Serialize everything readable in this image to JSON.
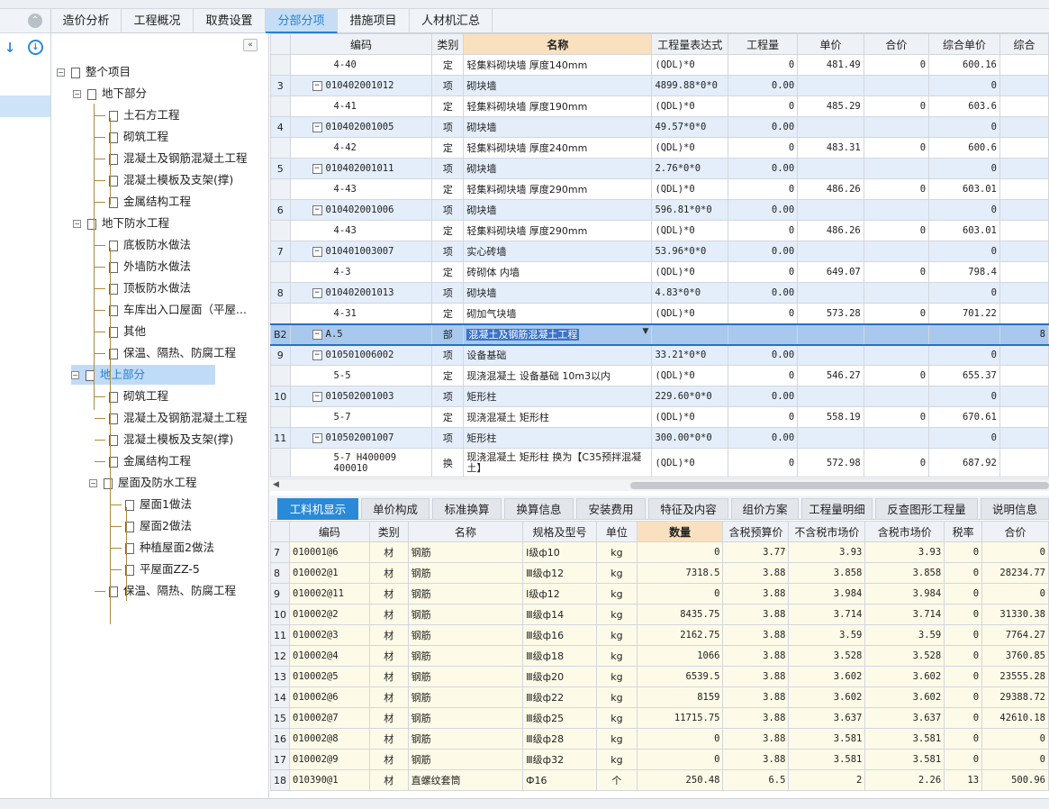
{
  "tabs": [
    "造价分析",
    "工程概况",
    "取费设置",
    "分部分项",
    "措施项目",
    "人材机汇总"
  ],
  "tree": {
    "root": "整个项目",
    "nodes": [
      {
        "label": "地下部分",
        "level": 1,
        "toggle": "−"
      },
      {
        "label": "土石方工程",
        "level": 2
      },
      {
        "label": "砌筑工程",
        "level": 2
      },
      {
        "label": "混凝土及钢筋混凝土工程",
        "level": 2
      },
      {
        "label": "混凝土模板及支架(撑)",
        "level": 2
      },
      {
        "label": "金属结构工程",
        "level": 2
      },
      {
        "label": "地下防水工程",
        "level": 1,
        "toggle": "−"
      },
      {
        "label": "底板防水做法",
        "level": 2
      },
      {
        "label": "外墙防水做法",
        "level": 2
      },
      {
        "label": "顶板防水做法",
        "level": 2
      },
      {
        "label": "车库出入口屋面（平屋...",
        "level": 2
      },
      {
        "label": "其他",
        "level": 2
      },
      {
        "label": "保温、隔热、防腐工程",
        "level": 2
      },
      {
        "label": "地上部分",
        "level": 1,
        "toggle": "−",
        "selected": true
      },
      {
        "label": "砌筑工程",
        "level": 2
      },
      {
        "label": "混凝土及钢筋混凝土工程",
        "level": 2
      },
      {
        "label": "混凝土模板及支架(撑)",
        "level": 2
      },
      {
        "label": "金属结构工程",
        "level": 2
      },
      {
        "label": "屋面及防水工程",
        "level": 2,
        "toggle": "−"
      },
      {
        "label": "屋面1做法",
        "level": 3
      },
      {
        "label": "屋面2做法",
        "level": 3
      },
      {
        "label": "种植屋面2做法",
        "level": 3
      },
      {
        "label": "平屋面ZZ-5",
        "level": 3
      },
      {
        "label": "保温、隔热、防腐工程",
        "level": 2
      }
    ]
  },
  "upper": {
    "headers": [
      "编码",
      "类别",
      "名称",
      "工程量表达式",
      "工程量",
      "单价",
      "合价",
      "综合单价",
      "综合"
    ],
    "rows": [
      {
        "rn": "",
        "code": "4-40",
        "type": "定",
        "name": "轻集料砌块墙 厚度140mm",
        "expr": "(QDL)*0",
        "qty": "0",
        "price": "481.49",
        "total": "0",
        "comp": "600.16",
        "kind": "ding"
      },
      {
        "rn": "3",
        "code": "010402001012",
        "type": "项",
        "name": "砌块墙",
        "expr": "4899.88*0*0",
        "qty": "0.00",
        "price": "",
        "total": "",
        "comp": "0",
        "kind": "xiang"
      },
      {
        "rn": "",
        "code": "4-41",
        "type": "定",
        "name": "轻集料砌块墙 厚度190mm",
        "expr": "(QDL)*0",
        "qty": "0",
        "price": "485.29",
        "total": "0",
        "comp": "603.6",
        "kind": "ding"
      },
      {
        "rn": "4",
        "code": "010402001005",
        "type": "项",
        "name": "砌块墙",
        "expr": "49.57*0*0",
        "qty": "0.00",
        "price": "",
        "total": "",
        "comp": "0",
        "kind": "xiang"
      },
      {
        "rn": "",
        "code": "4-42",
        "type": "定",
        "name": "轻集料砌块墙 厚度240mm",
        "expr": "(QDL)*0",
        "qty": "0",
        "price": "483.31",
        "total": "0",
        "comp": "600.6",
        "kind": "ding"
      },
      {
        "rn": "5",
        "code": "010402001011",
        "type": "项",
        "name": "砌块墙",
        "expr": "2.76*0*0",
        "qty": "0.00",
        "price": "",
        "total": "",
        "comp": "0",
        "kind": "xiang"
      },
      {
        "rn": "",
        "code": "4-43",
        "type": "定",
        "name": "轻集料砌块墙 厚度290mm",
        "expr": "(QDL)*0",
        "qty": "0",
        "price": "486.26",
        "total": "0",
        "comp": "603.01",
        "kind": "ding"
      },
      {
        "rn": "6",
        "code": "010402001006",
        "type": "项",
        "name": "砌块墙",
        "expr": "596.81*0*0",
        "qty": "0.00",
        "price": "",
        "total": "",
        "comp": "0",
        "kind": "xiang"
      },
      {
        "rn": "",
        "code": "4-43",
        "type": "定",
        "name": "轻集料砌块墙 厚度290mm",
        "expr": "(QDL)*0",
        "qty": "0",
        "price": "486.26",
        "total": "0",
        "comp": "603.01",
        "kind": "ding"
      },
      {
        "rn": "7",
        "code": "010401003007",
        "type": "项",
        "name": "实心砖墙",
        "expr": "53.96*0*0",
        "qty": "0.00",
        "price": "",
        "total": "",
        "comp": "0",
        "kind": "xiang"
      },
      {
        "rn": "",
        "code": "4-3",
        "type": "定",
        "name": "砖砌体 内墙",
        "expr": "(QDL)*0",
        "qty": "0",
        "price": "649.07",
        "total": "0",
        "comp": "798.4",
        "kind": "ding"
      },
      {
        "rn": "8",
        "code": "010402001013",
        "type": "项",
        "name": "砌块墙",
        "expr": "4.83*0*0",
        "qty": "0.00",
        "price": "",
        "total": "",
        "comp": "0",
        "kind": "xiang"
      },
      {
        "rn": "",
        "code": "4-31",
        "type": "定",
        "name": "砌加气块墙",
        "expr": "(QDL)*0",
        "qty": "0",
        "price": "573.28",
        "total": "0",
        "comp": "701.22",
        "kind": "ding"
      },
      {
        "rn": "B2",
        "code": "A.5",
        "type": "部",
        "name": "混凝土及钢筋混凝土工程",
        "expr": "",
        "qty": "",
        "price": "",
        "total": "",
        "comp": "",
        "extra": "8",
        "kind": "bu"
      },
      {
        "rn": "9",
        "code": "010501006002",
        "type": "项",
        "name": "设备基础",
        "expr": "33.21*0*0",
        "qty": "0.00",
        "price": "",
        "total": "",
        "comp": "0",
        "kind": "xiang"
      },
      {
        "rn": "",
        "code": "5-5",
        "type": "定",
        "name": "现浇混凝土 设备基础 10m3以内",
        "expr": "(QDL)*0",
        "qty": "0",
        "price": "546.27",
        "total": "0",
        "comp": "655.37",
        "kind": "ding"
      },
      {
        "rn": "10",
        "code": "010502001003",
        "type": "项",
        "name": "矩形柱",
        "expr": "229.60*0*0",
        "qty": "0.00",
        "price": "",
        "total": "",
        "comp": "0",
        "kind": "xiang"
      },
      {
        "rn": "",
        "code": "5-7",
        "type": "定",
        "name": "现浇混凝土 矩形柱",
        "expr": "(QDL)*0",
        "qty": "0",
        "price": "558.19",
        "total": "0",
        "comp": "670.61",
        "kind": "ding"
      },
      {
        "rn": "11",
        "code": "010502001007",
        "type": "项",
        "name": "矩形柱",
        "expr": "300.00*0*0",
        "qty": "0.00",
        "price": "",
        "total": "",
        "comp": "0",
        "kind": "xiang"
      },
      {
        "rn": "",
        "code": "5-7 H400009 400010",
        "type": "换",
        "name": "现浇混凝土 矩形柱  换为【C35预拌混凝土】",
        "expr": "(QDL)*0",
        "qty": "0",
        "price": "572.98",
        "total": "0",
        "comp": "687.92",
        "kind": "huan"
      }
    ]
  },
  "bottom_tabs": [
    "工料机显示",
    "单价构成",
    "标准换算",
    "换算信息",
    "安装费用",
    "特征及内容",
    "组价方案",
    "工程量明细",
    "反查图形工程量",
    "说明信息"
  ],
  "lower": {
    "headers": [
      "编码",
      "类别",
      "名称",
      "规格及型号",
      "单位",
      "数量",
      "含税预算价",
      "不含税市场价",
      "含税市场价",
      "税率",
      "合价"
    ],
    "rows": [
      {
        "rn": "7",
        "code": "010001@6",
        "type": "材",
        "name": "钢筋",
        "spec": "Ⅰ级ф10",
        "unit": "kg",
        "qty": "0",
        "p1": "3.77",
        "p2": "3.93",
        "p3": "3.93",
        "rate": "0",
        "total": "0"
      },
      {
        "rn": "8",
        "code": "010002@1",
        "type": "材",
        "name": "钢筋",
        "spec": "Ⅲ级ф12",
        "unit": "kg",
        "qty": "7318.5",
        "p1": "3.88",
        "p2": "3.858",
        "p3": "3.858",
        "rate": "0",
        "total": "28234.77"
      },
      {
        "rn": "9",
        "code": "010002@11",
        "type": "材",
        "name": "钢筋",
        "spec": "Ⅰ级ф12",
        "unit": "kg",
        "qty": "0",
        "p1": "3.88",
        "p2": "3.984",
        "p3": "3.984",
        "rate": "0",
        "total": "0"
      },
      {
        "rn": "10",
        "code": "010002@2",
        "type": "材",
        "name": "钢筋",
        "spec": "Ⅲ级ф14",
        "unit": "kg",
        "qty": "8435.75",
        "p1": "3.88",
        "p2": "3.714",
        "p3": "3.714",
        "rate": "0",
        "total": "31330.38"
      },
      {
        "rn": "11",
        "code": "010002@3",
        "type": "材",
        "name": "钢筋",
        "spec": "Ⅲ级ф16",
        "unit": "kg",
        "qty": "2162.75",
        "p1": "3.88",
        "p2": "3.59",
        "p3": "3.59",
        "rate": "0",
        "total": "7764.27"
      },
      {
        "rn": "12",
        "code": "010002@4",
        "type": "材",
        "name": "钢筋",
        "spec": "Ⅲ级ф18",
        "unit": "kg",
        "qty": "1066",
        "p1": "3.88",
        "p2": "3.528",
        "p3": "3.528",
        "rate": "0",
        "total": "3760.85"
      },
      {
        "rn": "13",
        "code": "010002@5",
        "type": "材",
        "name": "钢筋",
        "spec": "Ⅲ级ф20",
        "unit": "kg",
        "qty": "6539.5",
        "p1": "3.88",
        "p2": "3.602",
        "p3": "3.602",
        "rate": "0",
        "total": "23555.28"
      },
      {
        "rn": "14",
        "code": "010002@6",
        "type": "材",
        "name": "钢筋",
        "spec": "Ⅲ级ф22",
        "unit": "kg",
        "qty": "8159",
        "p1": "3.88",
        "p2": "3.602",
        "p3": "3.602",
        "rate": "0",
        "total": "29388.72"
      },
      {
        "rn": "15",
        "code": "010002@7",
        "type": "材",
        "name": "钢筋",
        "spec": "Ⅲ级ф25",
        "unit": "kg",
        "qty": "11715.75",
        "p1": "3.88",
        "p2": "3.637",
        "p3": "3.637",
        "rate": "0",
        "total": "42610.18"
      },
      {
        "rn": "16",
        "code": "010002@8",
        "type": "材",
        "name": "钢筋",
        "spec": "Ⅲ级ф28",
        "unit": "kg",
        "qty": "0",
        "p1": "3.88",
        "p2": "3.581",
        "p3": "3.581",
        "rate": "0",
        "total": "0"
      },
      {
        "rn": "17",
        "code": "010002@9",
        "type": "材",
        "name": "钢筋",
        "spec": "Ⅲ级ф32",
        "unit": "kg",
        "qty": "0",
        "p1": "3.88",
        "p2": "3.581",
        "p3": "3.581",
        "rate": "0",
        "total": "0"
      },
      {
        "rn": "18",
        "code": "010390@1",
        "type": "材",
        "name": "直螺纹套筒",
        "spec": "Ф16",
        "unit": "个",
        "qty": "250.48",
        "p1": "6.5",
        "p2": "2",
        "p3": "2.26",
        "rate": "13",
        "total": "500.96"
      }
    ]
  }
}
